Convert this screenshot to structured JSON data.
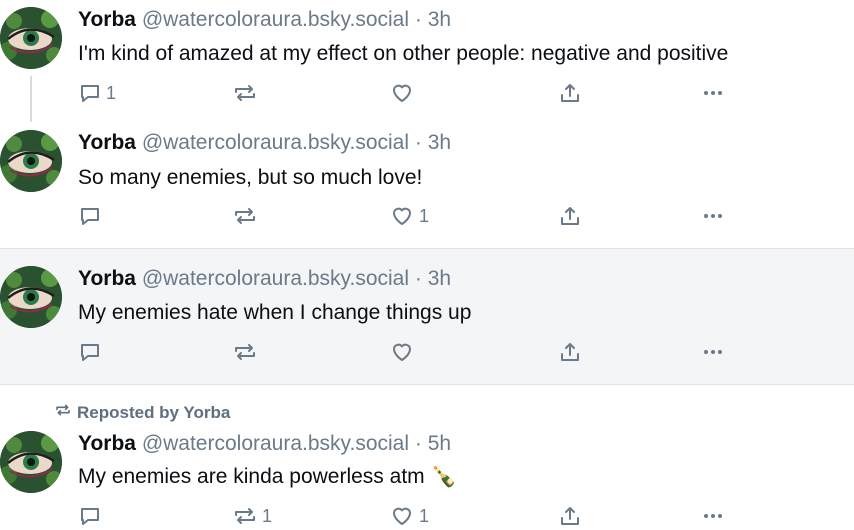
{
  "posts": [
    {
      "author": "Yorba",
      "handle": "@watercoloraura.bsky.social",
      "separator": "·",
      "time": "3h",
      "text": "I'm kind of amazed at my effect on other people: negative and positive",
      "replies": "1",
      "reposts": "",
      "likes": ""
    },
    {
      "author": "Yorba",
      "handle": "@watercoloraura.bsky.social",
      "separator": "·",
      "time": "3h",
      "text": "So many enemies, but so much love!",
      "replies": "",
      "reposts": "",
      "likes": "1"
    },
    {
      "author": "Yorba",
      "handle": "@watercoloraura.bsky.social",
      "separator": "·",
      "time": "3h",
      "text": "My enemies hate when I change things up",
      "replies": "",
      "reposts": "",
      "likes": ""
    },
    {
      "repost_label": "Reposted by Yorba",
      "author": "Yorba",
      "handle": "@watercoloraura.bsky.social",
      "separator": "·",
      "time": "5h",
      "text": "My enemies are kinda powerless atm 🍾",
      "replies": "",
      "reposts": "1",
      "likes": "1"
    }
  ],
  "icons": {
    "reply": "reply-icon",
    "repost": "repost-icon",
    "like": "heart-icon",
    "share": "share-icon",
    "more": "more-icon"
  },
  "colors": {
    "text": "#0b0f14",
    "muted": "#6b7a89",
    "highlight_bg": "#f3f5f7",
    "divider": "#dfe4ea"
  }
}
